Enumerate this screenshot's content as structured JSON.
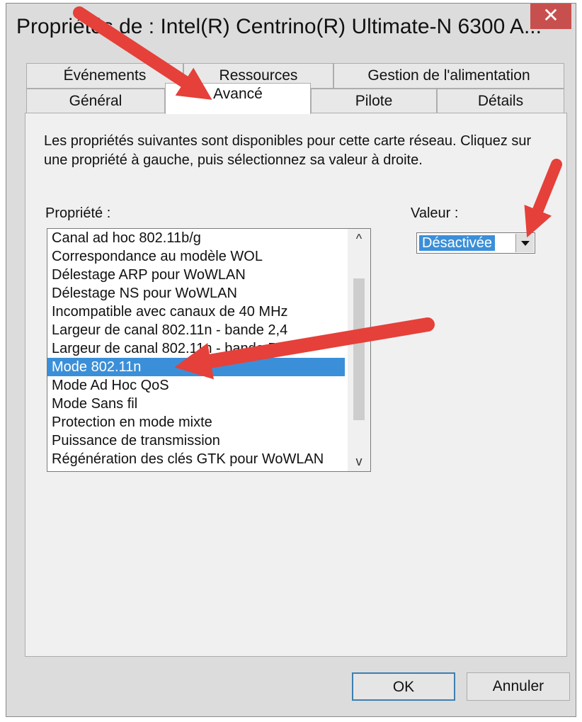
{
  "window": {
    "title": "Propriétés de : Intel(R) Centrino(R) Ultimate-N 6300 A...",
    "close_glyph": "✕"
  },
  "tabs": {
    "row1": [
      "Événements",
      "Ressources",
      "Gestion de l'alimentation"
    ],
    "row2": [
      "Général",
      "Avancé",
      "Pilote",
      "Détails"
    ],
    "active": "Avancé"
  },
  "content": {
    "description": "Les propriétés suivantes sont disponibles pour cette carte réseau. Cliquez sur une propriété à gauche, puis sélectionnez sa valeur à droite.",
    "property_label": "Propriété :",
    "value_label": "Valeur :",
    "properties": [
      "Canal ad hoc 802.11b/g",
      "Correspondance au modèle WOL",
      "Délestage ARP pour WoWLAN",
      "Délestage NS pour WoWLAN",
      "Incompatible avec canaux de 40 MHz",
      "Largeur de canal 802.11n - bande 2,4",
      "Largeur de canal 802.11n - bande 5,2",
      "Mode 802.11n",
      "Mode Ad Hoc QoS",
      "Mode Sans fil",
      "Protection en mode mixte",
      "Puissance de transmission",
      "Régénération des clés GTK pour WoWLAN"
    ],
    "selected_property": "Mode 802.11n",
    "selected_value": "Désactivée",
    "scroll_up_glyph": "^",
    "scroll_down_glyph": "v"
  },
  "buttons": {
    "ok": "OK",
    "cancel": "Annuler"
  },
  "colors": {
    "selection": "#3b8fd8",
    "close_button": "#c7504f",
    "annotation_arrow": "#e5403a"
  }
}
